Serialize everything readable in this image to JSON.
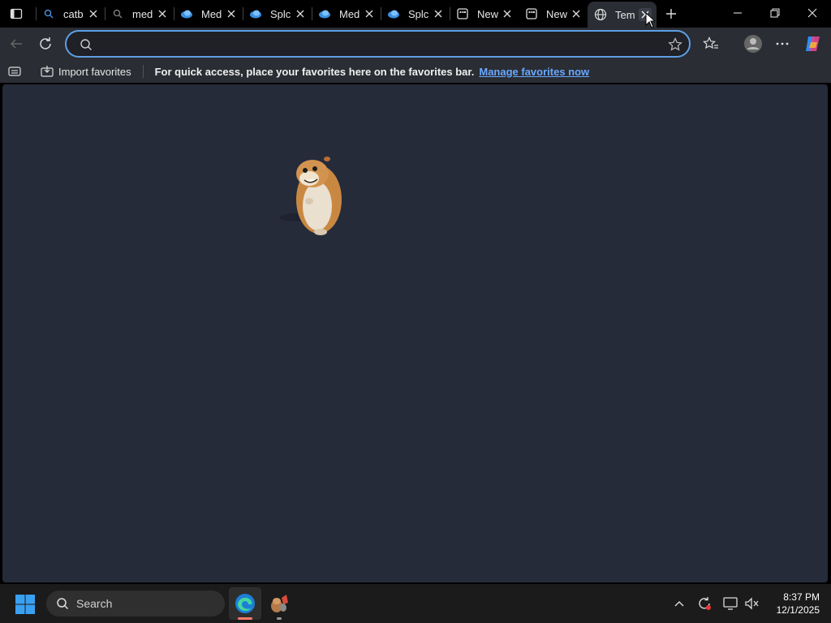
{
  "browser": {
    "tabs": [
      {
        "title": "catb",
        "favicon": "search-icon"
      },
      {
        "title": "med",
        "favicon": "search-icon"
      },
      {
        "title": "Med",
        "favicon": "cloud-icon"
      },
      {
        "title": "Splc",
        "favicon": "cloud-icon"
      },
      {
        "title": "Med",
        "favicon": "cloud-icon"
      },
      {
        "title": "Splc",
        "favicon": "cloud-icon"
      },
      {
        "title": "New",
        "favicon": "new-tab-icon"
      },
      {
        "title": "New",
        "favicon": "new-tab-icon"
      },
      {
        "title": "Tem",
        "favicon": "globe-icon"
      }
    ],
    "address_bar": {
      "value": "",
      "placeholder": ""
    },
    "favorites_bar": {
      "import_label": "Import favorites",
      "message": "For quick access, place your favorites here on the favorites bar.",
      "manage_link": "Manage favorites now"
    }
  },
  "taskbar": {
    "search_placeholder": "Search",
    "time": "8:37 PM",
    "date": "12/1/2025"
  },
  "colors": {
    "accent": "#5e9fe6",
    "link": "#6aa8ff",
    "content_bg": "#262b3a",
    "toolbar_bg": "#2a2d33"
  }
}
